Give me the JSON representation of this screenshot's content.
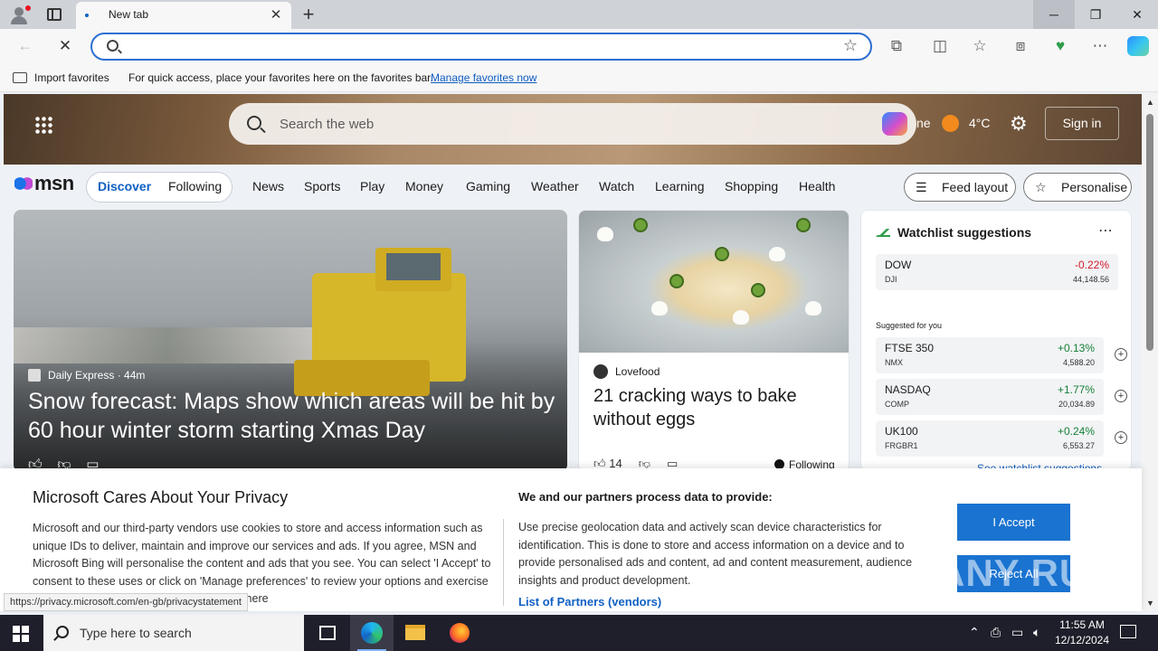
{
  "browser": {
    "tab_title": "New tab",
    "address_value": "",
    "favorites_bar": {
      "import_label": "Import favorites",
      "message": "For quick access, place your favorites here on the favorites bar.",
      "manage_link": "Manage favorites now"
    }
  },
  "msn": {
    "search_placeholder": "Search the web",
    "weather_city_partial": "ne",
    "temperature": "4°C",
    "sign_in": "Sign in",
    "logo_text": "msn",
    "feed_tabs": [
      "Discover",
      "Following"
    ],
    "nav_links": [
      "News",
      "Sports",
      "Play",
      "Money",
      "Gaming",
      "Weather",
      "Watch",
      "Learning",
      "Shopping",
      "Health"
    ],
    "feed_layout": "Feed layout",
    "personalise": "Personalise"
  },
  "cards": {
    "main": {
      "source": "Daily Express",
      "age": "44m",
      "headline": "Snow forecast: Maps show which areas will be hit by 60 hour winter storm starting Xmas Day"
    },
    "food": {
      "source": "Lovefood",
      "headline": "21 cracking ways to bake without eggs",
      "likes": "14",
      "following": "Following"
    }
  },
  "watchlist": {
    "title": "Watchlist suggestions",
    "main_stock": {
      "symbol": "DOW",
      "exchange": "DJI",
      "change": "-0.22%",
      "price": "44,148.56"
    },
    "suggested_label": "Suggested for you",
    "suggested": [
      {
        "symbol": "FTSE 350",
        "exchange": "NMX",
        "change": "+0.13%",
        "price": "4,588.20"
      },
      {
        "symbol": "NASDAQ",
        "exchange": "COMP",
        "change": "+1.77%",
        "price": "20,034.89"
      },
      {
        "symbol": "UK100",
        "exchange": "FRGBR1",
        "change": "+0.24%",
        "price": "6,553.27"
      }
    ],
    "see_all": "See watchlist suggestions"
  },
  "privacy": {
    "title": "Microsoft Cares About Your Privacy",
    "text": "Microsoft and our third-party vendors use cookies to store and access information such as unique IDs to deliver, maintain and improve our services and ads. If you agree, MSN and Microsoft Bing will personalise the content and ads that you see. You can select 'I Accept' to consent to these uses or click on 'Manage preferences' to review your options and exercise your right to object to Legitimate Interest where",
    "title2": "We and our partners process data to provide:",
    "text2": "Use precise geolocation data and actively scan device characteristics for identification. This is done to store and access information on a device and to provide personalised ads and content, ad and content measurement, audience insights and product development.",
    "partners_link": "List of Partners (vendors)",
    "accept": "I Accept",
    "reject": "Reject All"
  },
  "status_url": "https://privacy.microsoft.com/en-gb/privacystatement",
  "watermark": "ANY RUN",
  "taskbar": {
    "search_placeholder": "Type here to search",
    "time": "11:55 AM",
    "date": "12/12/2024"
  }
}
